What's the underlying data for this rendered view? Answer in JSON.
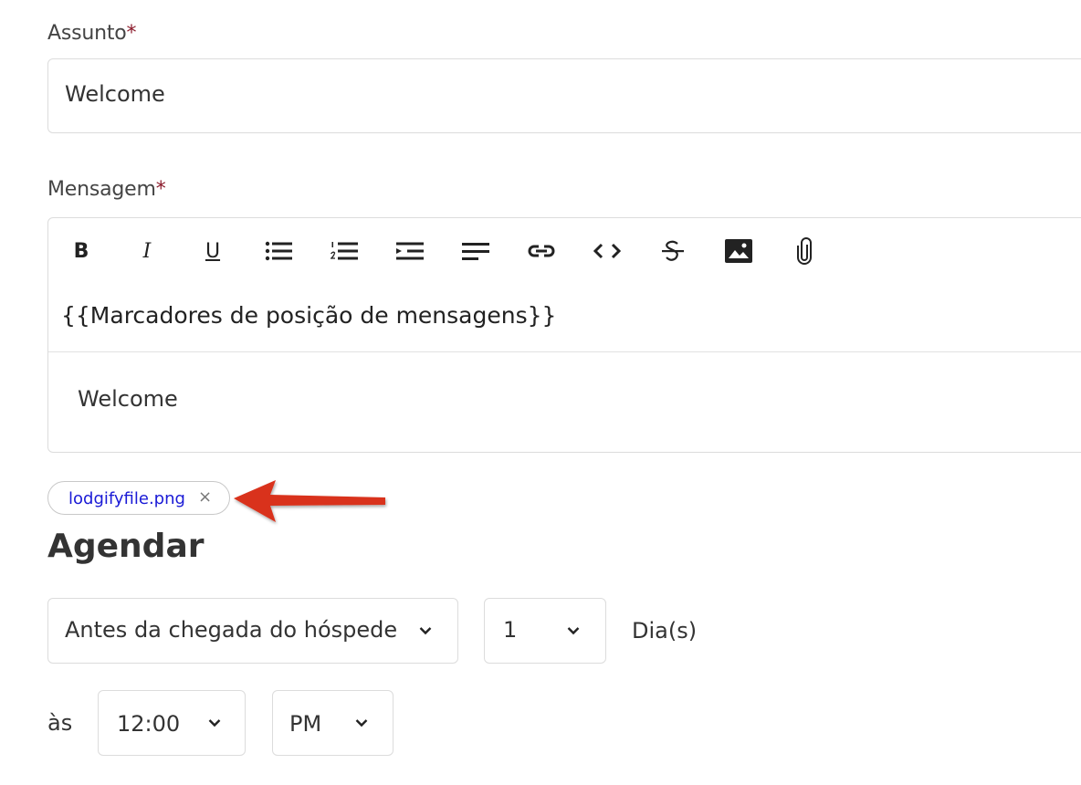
{
  "subject": {
    "label": "Assunto",
    "required_mark": "*",
    "value": "Welcome"
  },
  "message": {
    "label": "Mensagem",
    "required_mark": "*",
    "toolbar": {
      "bold": "B",
      "italic": "I",
      "underline": "U",
      "icons": [
        "bold-icon",
        "italic-icon",
        "underline-icon",
        "bulleted-list-icon",
        "numbered-list-icon",
        "indent-icon",
        "align-icon",
        "link-icon",
        "code-icon",
        "strikethrough-icon",
        "image-icon",
        "attachment-icon"
      ]
    },
    "placeholders_label": "{{Marcadores de posição de mensagens}}",
    "body": "Welcome"
  },
  "attachment": {
    "file_name": "lodgifyfile.png",
    "remove_symbol": "×"
  },
  "schedule": {
    "title": "Agendar",
    "when_value": "Antes da chegada do hóspede",
    "count_value": "1",
    "unit_label": "Dia(s)",
    "at_label": "às",
    "time_value": "12:00",
    "ampm_value": "PM"
  },
  "colors": {
    "required": "#8b1a2b",
    "link": "#1a1ad6",
    "annotation_arrow": "#d9301a",
    "border": "#dcdcdc"
  }
}
